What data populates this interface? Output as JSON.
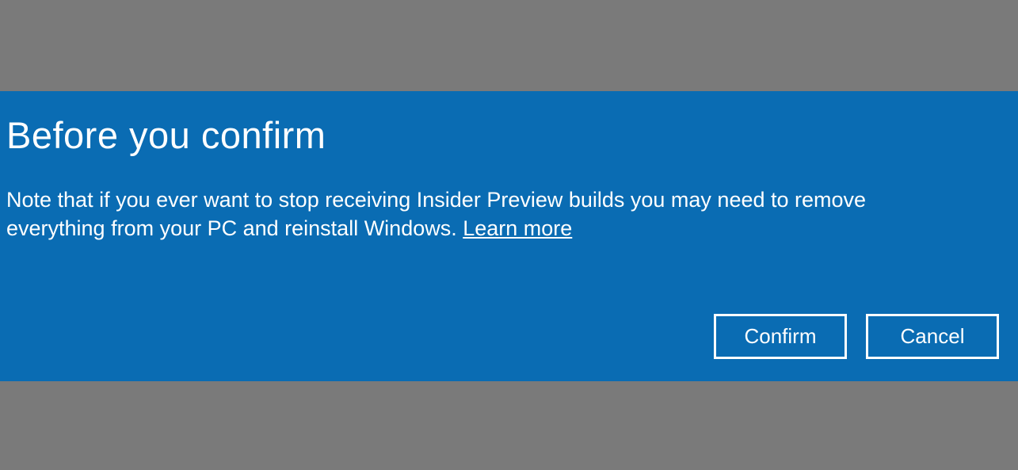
{
  "dialog": {
    "title": "Before you confirm",
    "note": "Note that if you ever want to stop receiving Insider Preview builds you may need to remove everything from your PC and reinstall Windows. ",
    "learn_more": "Learn more",
    "confirm_label": "Confirm",
    "cancel_label": "Cancel"
  },
  "colors": {
    "dialog_bg": "#0a6cb3",
    "page_bg": "#7a7a7a",
    "text": "#ffffff"
  }
}
